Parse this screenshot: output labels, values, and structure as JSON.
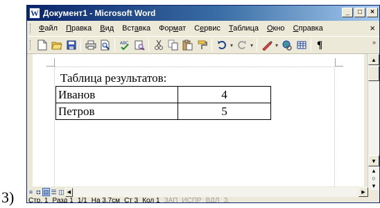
{
  "task_label": "3)",
  "window": {
    "title": "Документ1 - Microsoft Word",
    "app_icon_letter": "W",
    "btn_minimize": "_",
    "btn_maximize": "□",
    "btn_close": "×"
  },
  "menu": {
    "items": [
      {
        "pre": "",
        "u": "Ф",
        "post": "айл"
      },
      {
        "pre": "",
        "u": "П",
        "post": "равка"
      },
      {
        "pre": "",
        "u": "В",
        "post": "ид"
      },
      {
        "pre": "Вст",
        "u": "а",
        "post": "вка"
      },
      {
        "pre": "Фор",
        "u": "м",
        "post": "ат"
      },
      {
        "pre": "С",
        "u": "е",
        "post": "рвис"
      },
      {
        "pre": "",
        "u": "Т",
        "post": "аблица"
      },
      {
        "pre": "",
        "u": "О",
        "post": "кно"
      },
      {
        "pre": "",
        "u": "С",
        "post": "правка"
      }
    ],
    "close_glyph": "×"
  },
  "toolbar": {
    "paragraph_mark": "¶",
    "dropdown_glyph": "▾",
    "more_glyph": "»"
  },
  "document": {
    "heading": "Таблица результатов:",
    "table_rows": [
      {
        "name": "Иванов",
        "value": "4"
      },
      {
        "name": "Петров",
        "value": "5"
      }
    ]
  },
  "statusbar": {
    "page": "Стр. 1",
    "section": "Разд 1",
    "pages": "1/1",
    "at": "На 3,7см",
    "line": "Ст 3",
    "col": "Кол 1",
    "rec": "ЗАП",
    "trk": "ИСПР",
    "ext": "ВДЛ",
    "ovr": "З."
  },
  "icons": [
    "new-document-icon",
    "open-folder-icon",
    "save-icon",
    "print-icon",
    "print-preview-icon",
    "spelling-icon",
    "research-icon",
    "cut-icon",
    "copy-icon",
    "paste-icon",
    "format-painter-icon",
    "undo-icon",
    "redo-icon",
    "drawing-icon",
    "hyperlink-icon",
    "table-icon",
    "paragraph-mark-icon"
  ],
  "colors": {
    "title_gradient_start": "#0a246a",
    "title_gradient_end": "#a6caf0",
    "chrome": "#ece9d8",
    "document_bg": "#ffffff"
  }
}
